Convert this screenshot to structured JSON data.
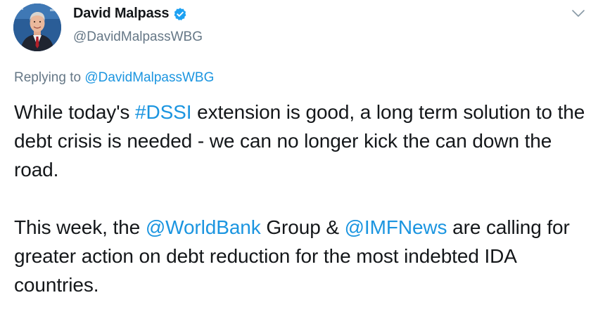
{
  "author": {
    "display_name": "David Malpass",
    "handle": "@DavidMalpassWBG",
    "verified_icon": "verified-badge-icon",
    "avatar_icon": "profile-photo"
  },
  "reply": {
    "prefix": "Replying to ",
    "mention": "@DavidMalpassWBG"
  },
  "tweet": {
    "p1": {
      "t1": "While today's ",
      "hashtag": "#DSSI",
      "t2": " extension is good, a long term solution to the debt crisis is needed - we can no longer kick the can down the road."
    },
    "p2": {
      "t1": "This week, the ",
      "mention1": "@WorldBank",
      "t2": " Group & ",
      "mention2": "@IMFNews",
      "t3": " are calling for greater action on debt reduction for the most indebted IDA countries."
    }
  },
  "colors": {
    "link": "#1b95e0",
    "secondary_text": "#657786",
    "verified": "#1da1f2"
  }
}
